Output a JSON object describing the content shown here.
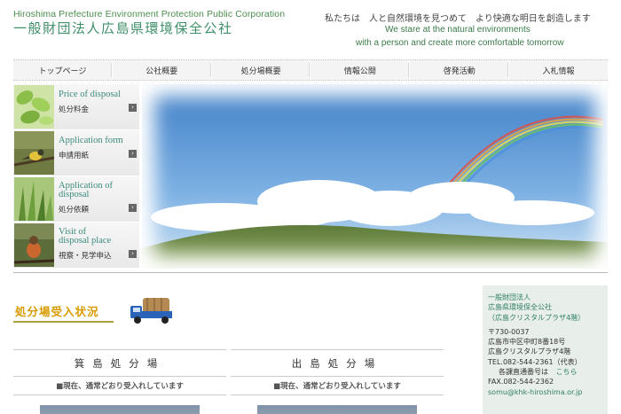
{
  "header": {
    "org_en": "Hiroshima Prefecture Environment Protection Public Corporation",
    "org_jp": "一般財団法人広島県環境保全公社",
    "tagline_jp": "私たちは　人と自然環境を見つめて　より快適な明日を創造します",
    "tagline_en1": "We stare at the natural environments",
    "tagline_en2": "with a person and create more comfortable tomorrow"
  },
  "nav": {
    "items": [
      "トップページ",
      "公社概要",
      "処分場概要",
      "情報公開",
      "啓発活動",
      "入札情報"
    ]
  },
  "sidebar": {
    "items": [
      {
        "en_line1": "Price of disposal",
        "en_line2": "",
        "jp": "処分料金"
      },
      {
        "en_line1": "Application form",
        "en_line2": "",
        "jp": "申請用紙"
      },
      {
        "en_line1": "Application of",
        "en_line2": "disposal",
        "jp": "処分依頼"
      },
      {
        "en_line1": "Visit of",
        "en_line2": "disposal place",
        "jp": "視察・見学申込"
      }
    ],
    "arrow_glyph": "›"
  },
  "status": {
    "title": "処分場受入状況"
  },
  "sites": [
    {
      "name": "箕島処分場",
      "status": "■現在、通常どおり受入れしています"
    },
    {
      "name": "出島処分場",
      "status": "■現在、通常どおり受入れしています"
    }
  ],
  "contact": {
    "name1": "一般財団法人",
    "name2": "広島県環境保全公社",
    "name3": "（広島クリスタルプラザ4階）",
    "zip": "〒730-0037",
    "addr1": "広島市中区中町8番18号",
    "addr2": "広島クリスタルプラザ4階",
    "tel": "TEL.082-544-2361（代表）",
    "dept_label": "各課直通番号は",
    "dept_link": "こちら",
    "fax": "FAX.082-544-2362",
    "email": "somu@khk-hiroshima.or.jp"
  },
  "colors": {
    "accent_green": "#3f8f6a",
    "title_orange": "#d89a00",
    "olive": "#8f8a20"
  },
  "icons": [
    "arrow-right-icon",
    "truck-icon",
    "rainbow-image"
  ]
}
